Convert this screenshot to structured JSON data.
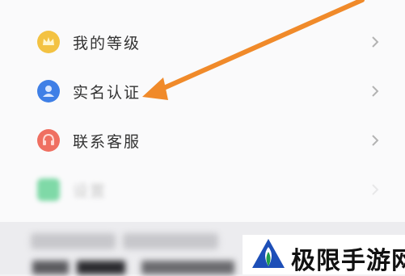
{
  "menu": {
    "items": [
      {
        "label": "我的等级",
        "icon": "crown-icon",
        "color": "#f3c242"
      },
      {
        "label": "实名认证",
        "icon": "user-id-icon",
        "color": "#3f7fe6"
      },
      {
        "label": "联系客服",
        "icon": "service-icon",
        "color": "#ef6f61"
      },
      {
        "label": "设置",
        "icon": "settings-icon",
        "color": "#7fd9a7"
      }
    ]
  },
  "watermark": {
    "text": "极限手游网",
    "colors": {
      "blue": "#1d4fb8",
      "green": "#1f9e4a"
    }
  },
  "annotation": {
    "arrow_color": "#f08a2a"
  }
}
